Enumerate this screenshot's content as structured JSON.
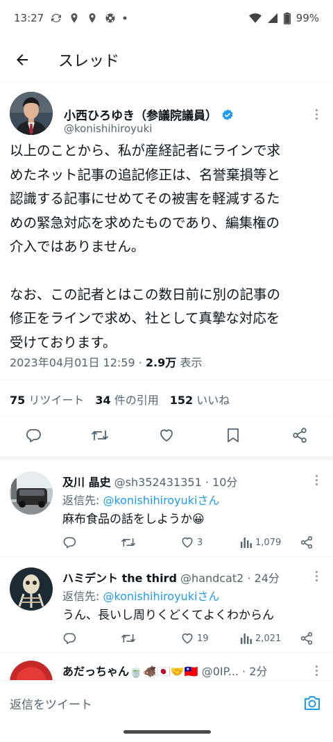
{
  "status_bar": {
    "time": "13:27",
    "battery": "99%"
  },
  "header": {
    "title": "スレッド"
  },
  "main_tweet": {
    "author_name": "小西ひろゆき（参議院議員）",
    "handle": "@konishihiroyuki",
    "paragraph1": "以上のことから、私が産経記者にラインで求\nめたネット記事の追記修正は、名誉棄損等と\n認識する記事にせめてその被害を軽減するた\nめの緊急対応を求めたものであり、編集権の\n介入ではありません。",
    "paragraph2": "なお、この記者とはこの数日前に別の記事の\n修正をラインで求め、社として真摯な対応を\n受けております。",
    "timestamp": "2023年04月01日 12:59 · ",
    "views_count": "2.9万",
    "views_label": " 表示",
    "retweets_count": "75",
    "retweets_label": " リツイート",
    "quotes_count": "34",
    "quotes_label": " 件の引用",
    "likes_count": "152",
    "likes_label": " いいね"
  },
  "replies": [
    {
      "name": "及川 晶史",
      "handle_time": " @sh352431351 · 10分",
      "reply_to_label": "返信先: ",
      "reply_to_user": "@konishihiroyukiさん",
      "text": "麻布食品の話をしようか😀",
      "likes": "3",
      "views": "1,079"
    },
    {
      "name": "ハミデント the third",
      "handle_time": " @handcat2 · 24分",
      "reply_to_label": "返信先: ",
      "reply_to_user": "@konishihiroyukiさん",
      "text": "うん、長いし周りくどくてよくわからん",
      "likes": "19",
      "views": "2,021"
    },
    {
      "name": "あだっちゃん🍵🐗🇯🇵🤝🇹🇼",
      "handle_time": " @0IP... · 2分"
    }
  ],
  "compose": {
    "placeholder": "返信をツイート"
  },
  "colors": {
    "accent": "#1d9bf0",
    "text": "#0f1419",
    "secondary": "#536471",
    "verified": "#1d9bf0"
  },
  "icons": [
    "back-arrow-icon",
    "reply-icon",
    "retweet-icon",
    "like-icon",
    "bookmark-icon",
    "share-icon",
    "views-icon",
    "camera-icon",
    "verified-badge-icon",
    "more-icon"
  ]
}
